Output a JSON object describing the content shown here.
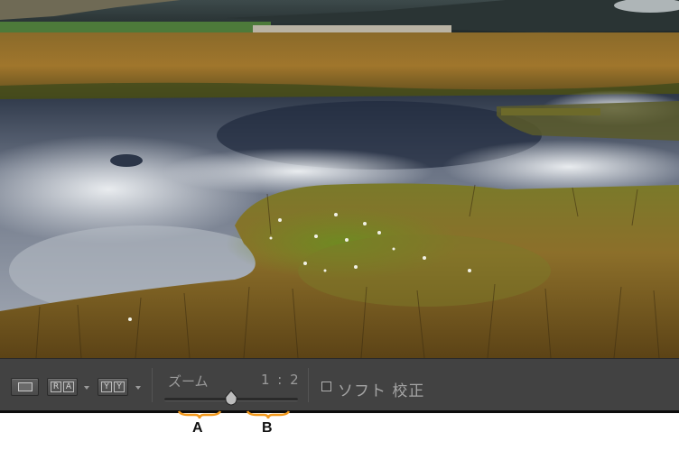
{
  "toolbar": {
    "zoom_label": "ズーム",
    "zoom_ratio": "1 : 2",
    "zoom_slider_fraction": 0.5,
    "soft_proof_label": "ソフト 校正",
    "soft_proof_checked": false,
    "compare_button": {
      "left": "R",
      "right": "A"
    },
    "survey_button": {
      "left": "Y",
      "right": "Y"
    },
    "icons": {
      "loupe": "loupe-view-icon",
      "compare": "compare-view-icon",
      "survey": "survey-view-icon",
      "dropdown": "chevron-down-icon"
    }
  },
  "annotations": {
    "a": "A",
    "b": "B",
    "bracket_color": "#f39a1e"
  },
  "photo": {
    "subject": "landscape-photo"
  }
}
